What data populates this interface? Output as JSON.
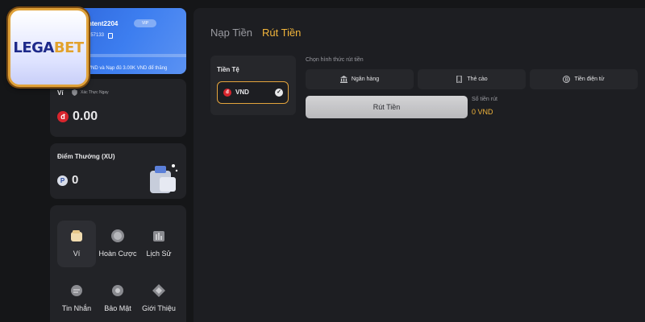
{
  "brand": {
    "logo_main": "LEGA",
    "logo_accent": "BET"
  },
  "profile": {
    "username": "ntent2204",
    "vip_badge": "VIP",
    "user_id": "157133",
    "vip_note": "VND và Nạp đủ 3.00K VND để thăng"
  },
  "wallet": {
    "title": "Ví",
    "verify_label": "Xác Thực Ngay",
    "currency_symbol": "đ",
    "balance": "0.00"
  },
  "points": {
    "title": "Điểm Thưởng (XU)",
    "symbol": "P",
    "value": "0"
  },
  "menu": {
    "wallet": "Ví",
    "cashback": "Hoàn Cược",
    "history": "Lịch Sử",
    "messages": "Tin Nhắn",
    "security": "Bảo Mật",
    "referral": "Giới Thiệu"
  },
  "tabs": {
    "deposit": "Nạp Tiền",
    "withdraw": "Rút Tiền"
  },
  "currency": {
    "title": "Tiền Tệ",
    "symbol": "đ",
    "selected": "VND",
    "check": "✓"
  },
  "methods": {
    "label": "Chọn hình thức rút tiền",
    "bank": "Ngân hàng",
    "card": "Thẻ cào",
    "crypto": "Tiền điện tử"
  },
  "withdraw": {
    "button": "Rút Tiền",
    "amount_label": "Số tiền rút",
    "amount_value": "0 VND"
  },
  "colors": {
    "accent": "#f2b53b",
    "profile_blue": "#3d7ef0",
    "dong_red": "#d8252d"
  }
}
